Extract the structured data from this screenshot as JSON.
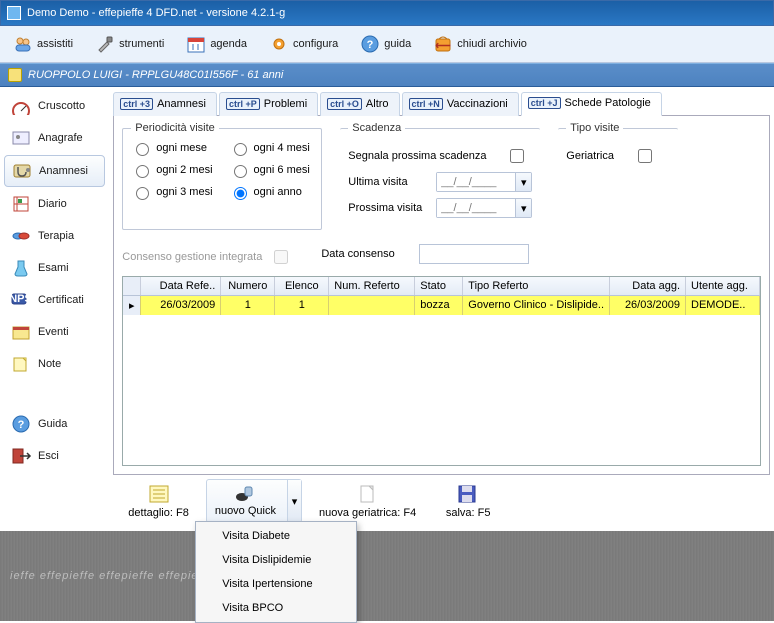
{
  "window": {
    "title": "Demo Demo - effepieffe 4 DFD.net - versione 4.2.1-g"
  },
  "toolbar": {
    "assistiti": "assistiti",
    "strumenti": "strumenti",
    "agenda": "agenda",
    "configura": "configura",
    "guida": "guida",
    "chiudi": "chiudi archivio"
  },
  "patient": {
    "line": "RUOPPOLO LUIGI - RPPLGU48C01I556F - 61 anni"
  },
  "sidebar": {
    "items": [
      {
        "label": "Cruscotto"
      },
      {
        "label": "Anagrafe"
      },
      {
        "label": "Anamnesi"
      },
      {
        "label": "Diario"
      },
      {
        "label": "Terapia"
      },
      {
        "label": "Esami"
      },
      {
        "label": "Certificati"
      },
      {
        "label": "Eventi"
      },
      {
        "label": "Note"
      },
      {
        "label": "Guida"
      },
      {
        "label": "Esci"
      }
    ]
  },
  "tabs": {
    "items": [
      {
        "key": "ctrl\n+3",
        "label": "Anamnesi"
      },
      {
        "key": "ctrl\n+P",
        "label": "Problemi"
      },
      {
        "key": "ctrl\n+O",
        "label": "Altro"
      },
      {
        "key": "ctrl\n+N",
        "label": "Vaccinazioni"
      },
      {
        "key": "ctrl\n+J",
        "label": "Schede Patologie"
      }
    ]
  },
  "periodicita": {
    "legend": "Periodicità visite",
    "opts": {
      "m1": "ogni mese",
      "m2": "ogni 2 mesi",
      "m3": "ogni 3 mesi",
      "m4": "ogni 4 mesi",
      "m6": "ogni 6 mesi",
      "anno": "ogni anno"
    }
  },
  "scadenza": {
    "legend": "Scadenza",
    "segnala": "Segnala prossima scadenza",
    "ultima": "Ultima visita",
    "prossima": "Prossima visita",
    "placeholder": "__/__/____"
  },
  "tipo": {
    "legend": "Tipo visite",
    "geriatrica": "Geriatrica"
  },
  "consenso": {
    "label": "Consenso gestione integrata",
    "data": "Data consenso",
    "value": ""
  },
  "table": {
    "headers": [
      "",
      "Data Refe..",
      "Numero",
      "Elenco",
      "Num. Referto",
      "Stato",
      "Tipo Referto",
      "Data agg.",
      "Utente agg."
    ],
    "row": {
      "data_ref": "26/03/2009",
      "numero": "1",
      "elenco": "1",
      "num_referto": "",
      "stato": "bozza",
      "tipo": "Governo Clinico - Dislipide..",
      "data_agg": "26/03/2009",
      "utente": "DEMODE.."
    }
  },
  "bottom": {
    "dettaglio": "dettaglio: F8",
    "nuovo_quick": "nuovo Quick",
    "nuova_ger": "nuova geriatrica: F4",
    "salva": "salva: F5"
  },
  "menu": {
    "items": [
      {
        "label": "Visita Diabete"
      },
      {
        "label": "Visita Dislipidemie"
      },
      {
        "label": "Visita Ipertensione"
      },
      {
        "label": "Visita BPCO"
      }
    ]
  },
  "watermark": "ieffe  effepieffe  effepieffe  effepieffe  effepieffe  eff"
}
